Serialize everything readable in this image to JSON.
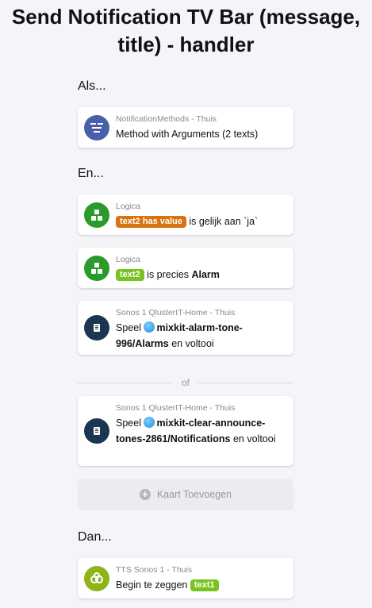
{
  "title": "Send Notification TV Bar (message, title) - handler",
  "sections": {
    "when": "Als...",
    "and": "En...",
    "then": "Dan..."
  },
  "or_label": "of",
  "add_card_label": "Kaart Toevoegen",
  "cards": {
    "trigger": {
      "source": "NotificationMethods - Thuis",
      "text": "Method with Arguments (2 texts)",
      "icon": "method-icon",
      "icon_color": "#4a5fa8"
    },
    "cond1": {
      "source": "Logica",
      "tag": "text2 has value",
      "tag_color": "#d9720f",
      "text": "is gelijk aan `ja`",
      "icon": "logic-icon",
      "icon_color": "#2a9a2a"
    },
    "cond2": {
      "source": "Logica",
      "tag": "text2",
      "tag_color": "#79c321",
      "text_pre": "is precies",
      "value": "Alarm",
      "icon": "logic-icon",
      "icon_color": "#2a9a2a"
    },
    "cond3": {
      "source": "Sonos 1 QlusterIT-Home - Thuis",
      "prefix": "Speel",
      "media": "mixkit-alarm-tone-996/Alarms",
      "suffix": "en voltooi",
      "icon": "sonos-icon",
      "icon_color": "#1c3550"
    },
    "cond4": {
      "source": "Sonos 1 QlusterIT-Home - Thuis",
      "prefix": "Speel",
      "media": "mixkit-clear-announce-tones-2861/Notifications",
      "suffix": "en voltooi",
      "icon": "sonos-icon",
      "icon_color": "#1c3550"
    },
    "action": {
      "source": "TTS Sonos 1 - Thuis",
      "text": "Begin te zeggen",
      "tag": "text1",
      "tag_color": "#79c321",
      "icon": "tts-icon",
      "icon_color": "#8fb31a"
    }
  }
}
